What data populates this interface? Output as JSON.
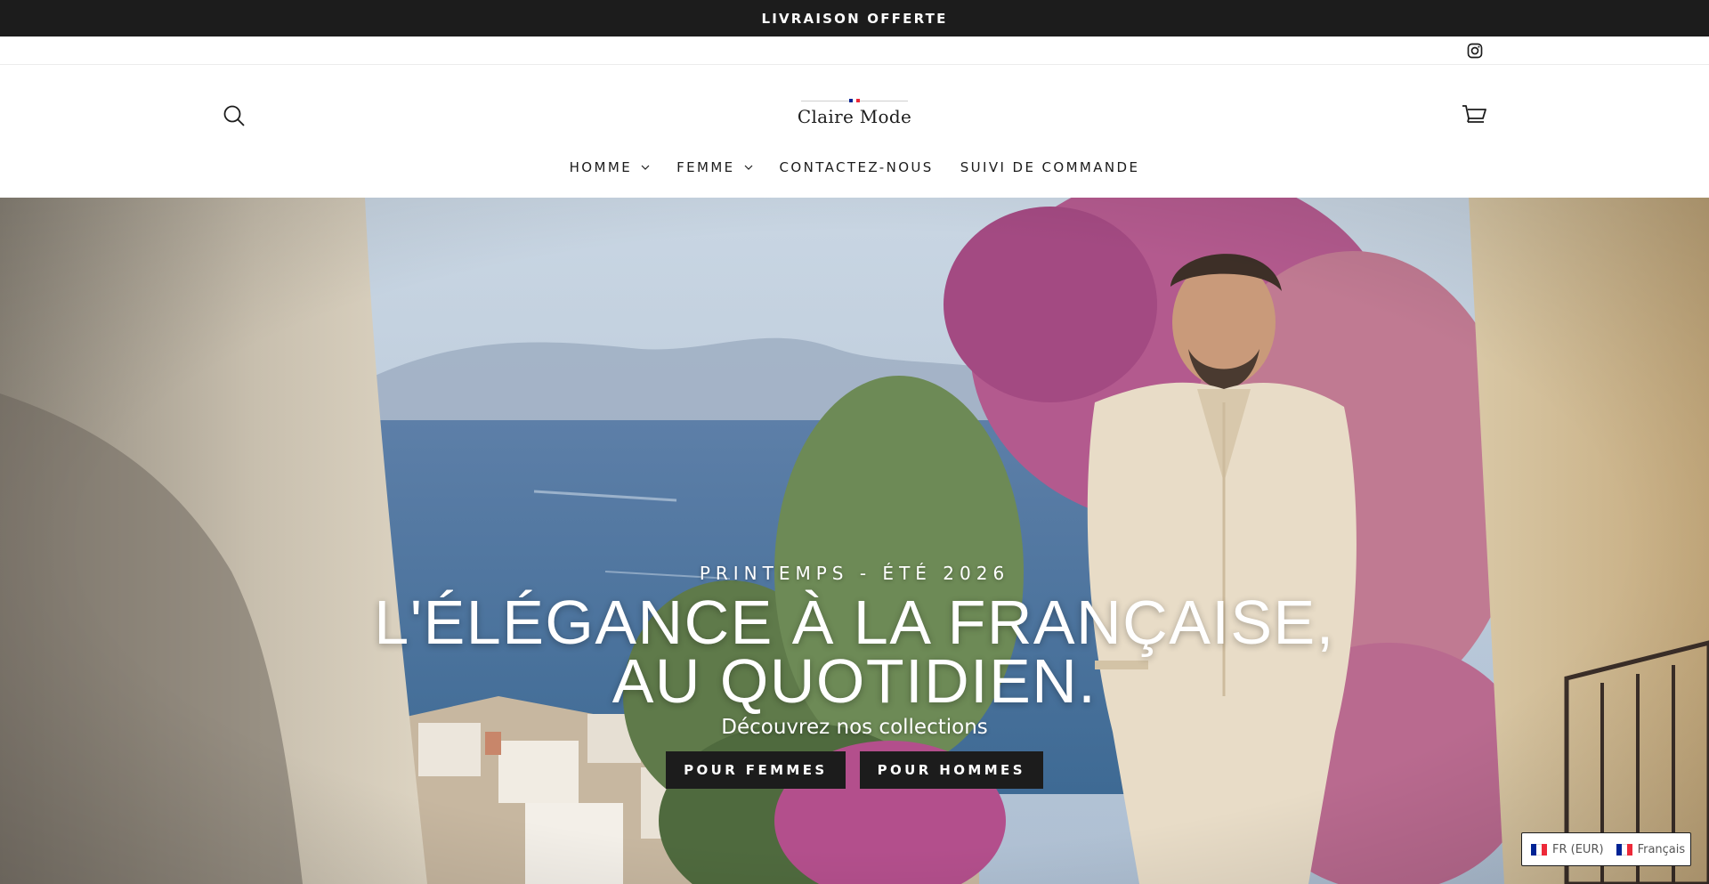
{
  "announcement": {
    "text": "LIVRAISON OFFERTE"
  },
  "social": {
    "instagram_icon": "instagram-icon"
  },
  "header": {
    "logo_text": "Claire Mode",
    "search_icon": "search-icon",
    "cart_icon": "cart-icon",
    "nav": [
      {
        "label": "HOMME",
        "has_dropdown": true
      },
      {
        "label": "FEMME",
        "has_dropdown": true
      },
      {
        "label": "CONTACTEZ-NOUS",
        "has_dropdown": false
      },
      {
        "label": "SUIVI DE COMMANDE",
        "has_dropdown": false
      }
    ]
  },
  "hero": {
    "eyebrow": "PRINTEMPS - ÉTÉ 2026",
    "headline_line1": "L'ÉLÉGANCE À LA FRANÇAISE,",
    "headline_line2": "AU QUOTIDIEN.",
    "subline": "Découvrez nos collections",
    "cta_women": "POUR FEMMES",
    "cta_men": "POUR HOMMES"
  },
  "locale": {
    "currency": "FR (EUR)",
    "language": "Français",
    "flag_colors": [
      "#002395",
      "#ffffff",
      "#ed2939"
    ]
  },
  "colors": {
    "dark": "#1c1c1c",
    "white": "#ffffff"
  }
}
